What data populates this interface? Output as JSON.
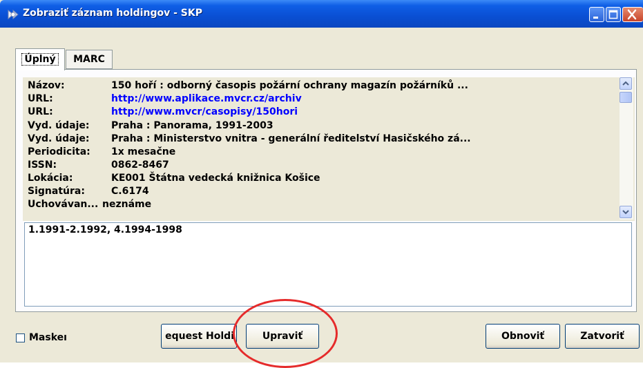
{
  "window": {
    "title": "Zobraziť záznam holdingov - SKP",
    "controls": {
      "minimize": "minimize",
      "maximize": "maximize",
      "close": "close"
    }
  },
  "tabs": [
    {
      "label": "Úplný",
      "active": true
    },
    {
      "label": "MARC",
      "active": false
    }
  ],
  "record": {
    "rows": [
      {
        "label": "Názov:",
        "value": "150 hoří : odborný časopis požární ochrany magazín požárníků ...",
        "link": false
      },
      {
        "label": "URL:",
        "value": "http://www.aplikace.mvcr.cz/archiv",
        "link": true
      },
      {
        "label": "URL:",
        "value": "http://www.mvcr/casopisy/150hori",
        "link": true
      },
      {
        "label": "Vyd. údaje:",
        "value": "Praha : Panorama, 1991-2003",
        "link": false
      },
      {
        "label": "Vyd. údaje:",
        "value": "Praha : Ministerstvo vnitra - generální ředitelství Hasičského zá...",
        "link": false
      },
      {
        "label": "Periodicita:",
        "value": "1x mesačne",
        "link": false
      },
      {
        "label": "ISSN:",
        "value": "0862-8467",
        "link": false
      },
      {
        "label": "Lokácia:",
        "value": "KE001 Štátna vedecká knižnica Košice",
        "link": false
      },
      {
        "label": "Signatúra:",
        "value": "C.6174",
        "link": false
      },
      {
        "label": "Uchovávan...",
        "value": "neznáme",
        "link": false
      }
    ]
  },
  "holdings_memo": {
    "text": "1.1991-2.1992, 4.1994-1998"
  },
  "footer": {
    "mask_checkbox": {
      "label": "Maskeı",
      "checked": false
    },
    "buttons": {
      "request": "equest Holdi",
      "edit": "Upraviť",
      "refresh": "Obnoviť",
      "close": "Zatvoriť"
    }
  },
  "colors": {
    "titlebar": "#0b4fd3",
    "link": "#0000ff",
    "face": "#ece9d8",
    "annotation": "#e52b2b"
  },
  "icons": [
    "app-icon",
    "minimize-icon",
    "maximize-icon",
    "close-icon",
    "scroll-up-icon",
    "scroll-down-icon"
  ]
}
